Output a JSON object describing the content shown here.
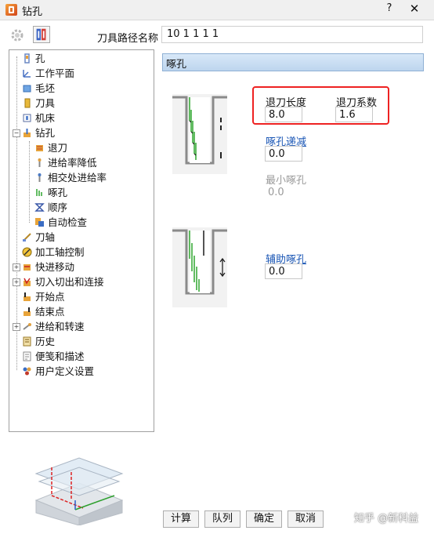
{
  "window": {
    "title": "钻孔",
    "help": "?",
    "close": "✕"
  },
  "toolpath_name": {
    "label": "刀具路径名称",
    "value": "10 1 1 1 1"
  },
  "tree": {
    "items": [
      {
        "label": "孔",
        "icon": "hole-icon"
      },
      {
        "label": "工作平面",
        "icon": "workplane-icon"
      },
      {
        "label": "毛坯",
        "icon": "block-icon"
      },
      {
        "label": "刀具",
        "icon": "tool-icon"
      },
      {
        "label": "机床",
        "icon": "machine-icon"
      },
      {
        "label": "钻孔",
        "icon": "drilling-icon"
      },
      {
        "label": "退刀",
        "icon": "retract-icon"
      },
      {
        "label": "进给率降低",
        "icon": "feedrate-reduction-icon"
      },
      {
        "label": "相交处进给率",
        "icon": "intersection-feedrate-icon"
      },
      {
        "label": "啄孔",
        "icon": "peck-icon"
      },
      {
        "label": "顺序",
        "icon": "sequence-icon"
      },
      {
        "label": "自动检查",
        "icon": "auto-check-icon"
      },
      {
        "label": "刀轴",
        "icon": "tool-axis-icon"
      },
      {
        "label": "加工轴控制",
        "icon": "axis-control-icon"
      },
      {
        "label": "快进移动",
        "icon": "rapid-move-icon"
      },
      {
        "label": "切入切出和连接",
        "icon": "leads-links-icon"
      },
      {
        "label": "开始点",
        "icon": "start-point-icon"
      },
      {
        "label": "结束点",
        "icon": "end-point-icon"
      },
      {
        "label": "进给和转速",
        "icon": "feeds-speeds-icon"
      },
      {
        "label": "历史",
        "icon": "history-icon"
      },
      {
        "label": "便笺和描述",
        "icon": "notes-icon"
      },
      {
        "label": "用户定义设置",
        "icon": "user-settings-icon"
      }
    ]
  },
  "panel": {
    "header": "啄孔",
    "retract_length": {
      "label": "退刀长度",
      "value": "8.0"
    },
    "retract_factor": {
      "label": "退刀系数",
      "value": "1.6"
    },
    "peck_decrement": {
      "label": "啄孔递减",
      "value": "0.0"
    },
    "minimum_peck": {
      "label": "最小啄孔",
      "value": "0.0"
    },
    "auxiliary_peck": {
      "label": "辅助啄孔",
      "value": "0.0"
    }
  },
  "buttons": {
    "calculate": "计算",
    "queue": "队列",
    "ok": "确定",
    "cancel": "取消"
  },
  "watermark": "知乎 @新科益",
  "colors": {
    "highlight_border": "#e22222",
    "link": "#1a56b5",
    "header_bg": "#c9dcf1"
  }
}
